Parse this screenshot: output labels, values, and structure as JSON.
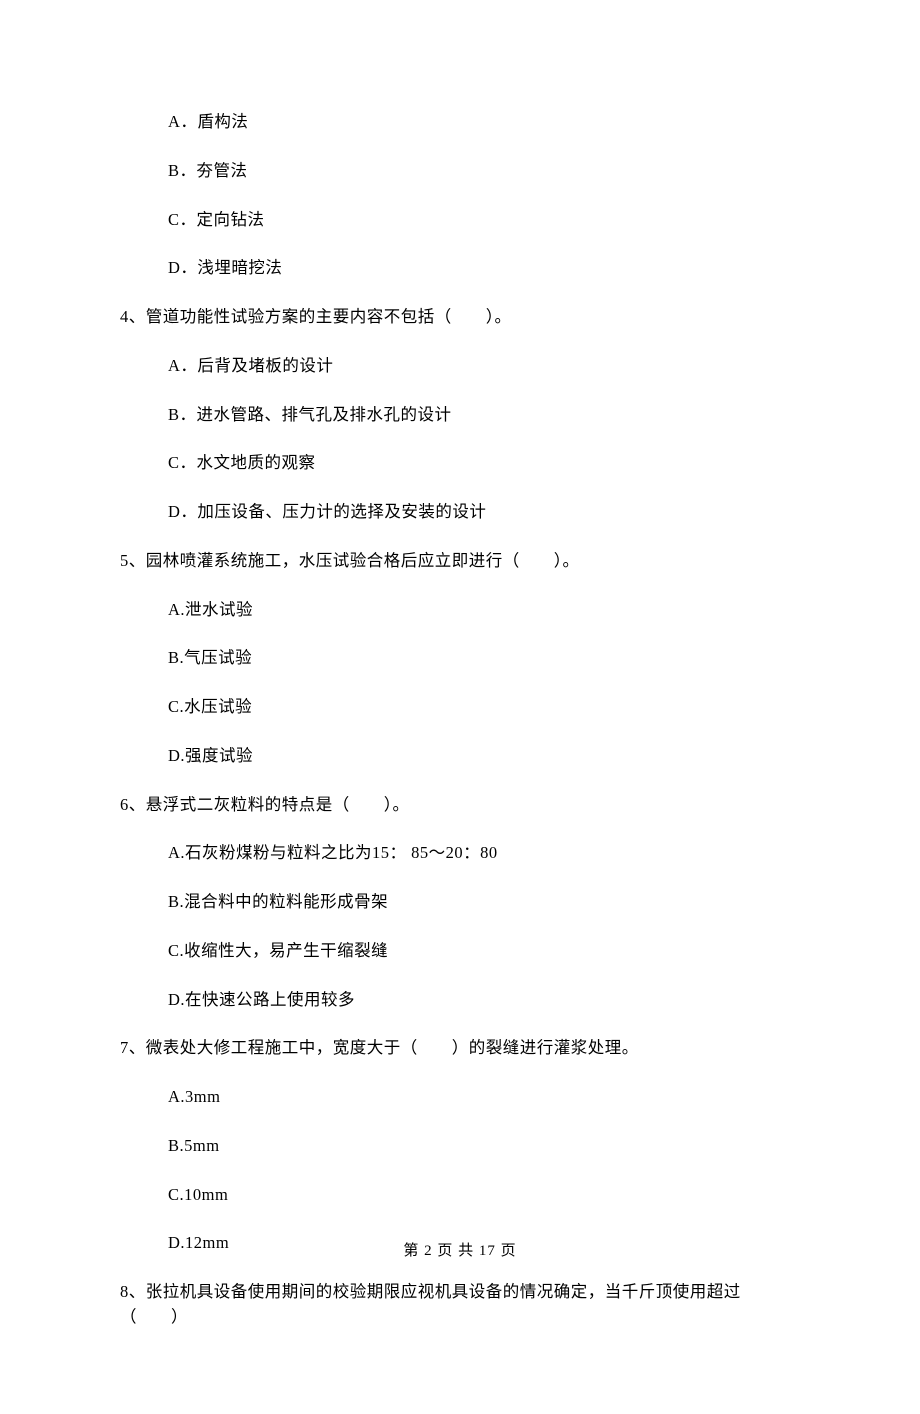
{
  "q3_options": {
    "a": "A．盾构法",
    "b": "B．夯管法",
    "c": "C．定向钻法",
    "d": "D．浅埋暗挖法"
  },
  "q4": {
    "stem": "4、管道功能性试验方案的主要内容不包括（　　）。",
    "a": "A．后背及堵板的设计",
    "b": "B．进水管路、排气孔及排水孔的设计",
    "c": "C．水文地质的观察",
    "d": "D．加压设备、压力计的选择及安装的设计"
  },
  "q5": {
    "stem": "5、园林喷灌系统施工，水压试验合格后应立即进行（　　）。",
    "a": "A.泄水试验",
    "b": "B.气压试验",
    "c": "C.水压试验",
    "d": "D.强度试验"
  },
  "q6": {
    "stem": "6、悬浮式二灰粒料的特点是（　　）。",
    "a": "A.石灰粉煤粉与粒料之比为15： 85～20：80",
    "b": "B.混合料中的粒料能形成骨架",
    "c": "C.收缩性大，易产生干缩裂缝",
    "d": "D.在快速公路上使用较多"
  },
  "q7": {
    "stem": "7、微表处大修工程施工中，宽度大于（　　）的裂缝进行灌浆处理。",
    "a": "A.3mm",
    "b": "B.5mm",
    "c": "C.10mm",
    "d": "D.12mm"
  },
  "q8": {
    "stem": "8、张拉机具设备使用期间的校验期限应视机具设备的情况确定，当千斤顶使用超过（　　）"
  },
  "footer": "第 2 页 共 17 页"
}
